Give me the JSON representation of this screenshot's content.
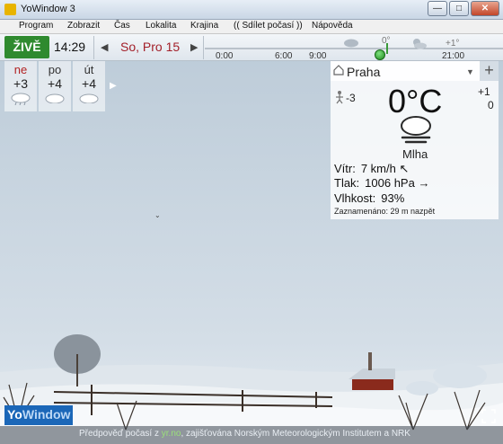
{
  "window": {
    "title": "YoWindow 3",
    "min": "—",
    "max": "□",
    "close": "✕"
  },
  "menu": [
    "Program",
    "Zobrazit",
    "Čas",
    "Lokalita",
    "Krajina",
    "(( Sdílet počasí ))",
    "Nápověda"
  ],
  "toolbar": {
    "live": "ŽIVĚ",
    "time": "14:29",
    "prev_arrow": "◀",
    "next_arrow": "▶",
    "date": "So, Pro 15",
    "timeline_hours": [
      "0:00",
      "6:00",
      "9:00",
      "21:00"
    ],
    "timeline_temp_label": "+1°",
    "timeline_temp_top": "0°"
  },
  "forecast": {
    "days": [
      {
        "name": "ne",
        "temp": "+3",
        "icon": "rain-cloud-icon",
        "weekend": true
      },
      {
        "name": "po",
        "temp": "+4",
        "icon": "cloud-icon",
        "weekend": false
      },
      {
        "name": "út",
        "temp": "+4",
        "icon": "cloud-icon",
        "weekend": false
      }
    ],
    "more_arrow": "▶"
  },
  "current": {
    "location": "Praha",
    "dropdown": "▼",
    "add": "+",
    "feels_like": "-3",
    "temp": "0°C",
    "high": "+1",
    "low": "0",
    "condition": "Mlha",
    "wind_label": "Vítr:",
    "wind_value": "7 km/h ↖",
    "pressure_label": "Tlak:",
    "pressure_value": "1006 hPa →",
    "humidity_label": "Vlhkost:",
    "humidity_value": "93%",
    "observed": "Zaznamenáno:  29 m nazpět"
  },
  "footer": {
    "credit_pre": "Předpověď počasí z ",
    "credit_link": "yr.no",
    "credit_post": ", zajišťována Norským Meteorologickým Institutem a NRK",
    "brand_yo": "Yo",
    "brand_window": "Window"
  },
  "colors": {
    "live_green": "#2f8a2f",
    "date_red": "#a3202a",
    "sky": "#cfd9e2",
    "brand_blue": "#1b67b8"
  }
}
